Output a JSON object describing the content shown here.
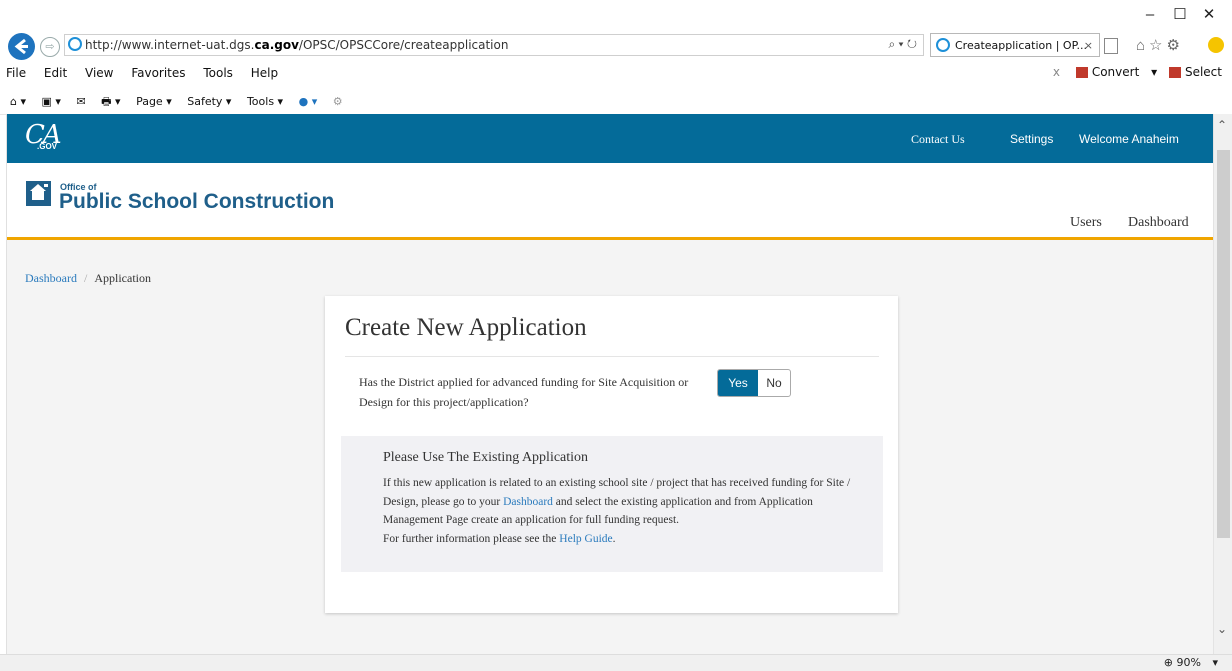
{
  "browser": {
    "url_prefix": "http://www.internet-uat.dgs.",
    "url_domain": "ca.gov",
    "url_path": "/OPSC/OPSCCore/createapplication",
    "tab_title": "Createapplication | OP...",
    "menu": [
      "File",
      "Edit",
      "View",
      "Favorites",
      "Tools",
      "Help"
    ],
    "convert_label": "Convert",
    "select_label": "Select",
    "commands": [
      "Page",
      "Safety",
      "Tools"
    ],
    "zoom": "90%"
  },
  "site": {
    "logo_text": "CA",
    "logo_sub": ".GOV",
    "nav": [
      "Contact Us",
      "Settings",
      "Welcome Anaheim"
    ],
    "brand_small": "Office of",
    "brand_big": "Public School Construction",
    "subnav": [
      "Users",
      "Dashboard"
    ]
  },
  "breadcrumb": {
    "home": "Dashboard",
    "current": "Application"
  },
  "form": {
    "title": "Create New Application",
    "question": "Has the District applied for advanced funding for Site Acquisition or Design for this project/application?",
    "yes_label": "Yes",
    "no_label": "No",
    "info_title": "Please Use The Existing Application",
    "info_p1": "If this new application is related to an existing school site / project that has received funding for Site / Design, please go to your ",
    "info_link1": "Dashboard",
    "info_p2": " and select the existing application and from Application Management Page create an application for full funding request.",
    "info_p3": "For further information please see the ",
    "info_link2": "Help Guide",
    "info_p4": "."
  },
  "colors": {
    "brand_blue": "#046b99",
    "accent_gold": "#f0a500",
    "link": "#2b7bbd"
  }
}
